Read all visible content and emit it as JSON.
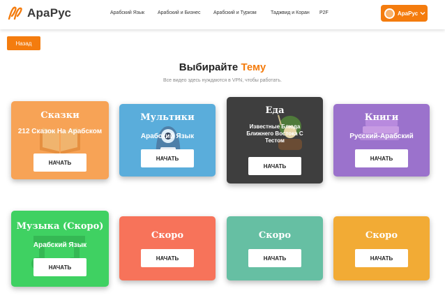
{
  "header": {
    "logo_text": "АраРус",
    "nav": [
      "Арабский Язык",
      "Арабский и Бизнес",
      "Арабский и Туризм",
      "Таджвид и Коран",
      "P2F"
    ],
    "user_name": "АраРус"
  },
  "back_label": "Назад",
  "page": {
    "title_main": "Выбирайте ",
    "title_accent": "Тему",
    "subtitle": "Все видео здесь нуждаются в VPN, чтобы работать."
  },
  "cards": [
    {
      "title": "Сказки",
      "subtitle": "212 Сказок На Арабском",
      "button": "НАЧАТЬ",
      "color": "#f7a356",
      "icon": "open-book-icon"
    },
    {
      "title": "Мультики",
      "subtitle": "Арабский Язык",
      "button": "НАЧАТЬ",
      "color": "#5aaddb",
      "icon": "cartoon-monster-icon"
    },
    {
      "title": "Еда",
      "subtitle": "Известные Блюда Ближнего Востока С Тестом",
      "button": "НАЧАТЬ",
      "color": "#3e3e3e",
      "icon": "food-bowl-icon"
    },
    {
      "title": "Книги",
      "subtitle": "Русский-Арабский",
      "button": "НАЧАТЬ",
      "color": "#9b72cc",
      "icon": "book-stack-icon"
    },
    {
      "title": "Музыка (Скоро)",
      "subtitle": "Арабский Язык",
      "button": "НАЧАТЬ",
      "color": "#3fd162",
      "icon": "music-note-icon"
    },
    {
      "title": "Скоро",
      "subtitle": "",
      "button": "НАЧАТЬ",
      "color": "#f7735a",
      "icon": ""
    },
    {
      "title": "Скоро",
      "subtitle": "",
      "button": "НАЧАТЬ",
      "color": "#66bfa3",
      "icon": ""
    },
    {
      "title": "Скоро",
      "subtitle": "",
      "button": "НАЧАТЬ",
      "color": "#f2ab35",
      "icon": ""
    }
  ],
  "colors": {
    "accent": "#f47c0e"
  }
}
